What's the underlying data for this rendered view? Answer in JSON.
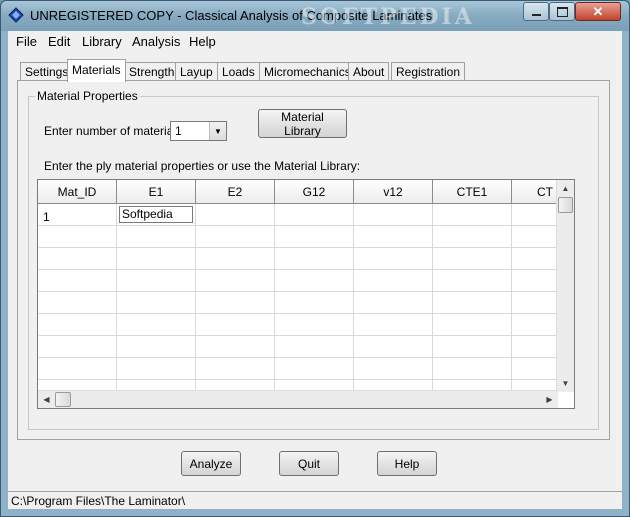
{
  "window": {
    "title": "UNREGISTERED COPY - Classical Analysis of Composite Laminates",
    "watermark": "SOFTPEDIA"
  },
  "menu": [
    "File",
    "Edit",
    "Library",
    "Analysis",
    "Help"
  ],
  "tabs": [
    "Settings",
    "Materials",
    "Strength",
    "Layup",
    "Loads",
    "Micromechanics",
    "About",
    "Registration"
  ],
  "active_tab": "Materials",
  "materials": {
    "group_title": "Material Properties",
    "num_materials_label": "Enter number of materials:",
    "num_materials_value": "1",
    "library_button": "Material Library",
    "instructions": "Enter the ply material properties or use the Material Library:",
    "grid": {
      "columns": [
        "Mat_ID",
        "E1",
        "E2",
        "G12",
        "v12",
        "CTE1",
        "CT"
      ],
      "rows": [
        [
          "1",
          "Softpedia",
          "",
          "",
          "",
          "",
          ""
        ]
      ]
    }
  },
  "buttons": {
    "analyze": "Analyze",
    "quit": "Quit",
    "help": "Help"
  },
  "status": "C:\\Program Files\\The Laminator\\"
}
